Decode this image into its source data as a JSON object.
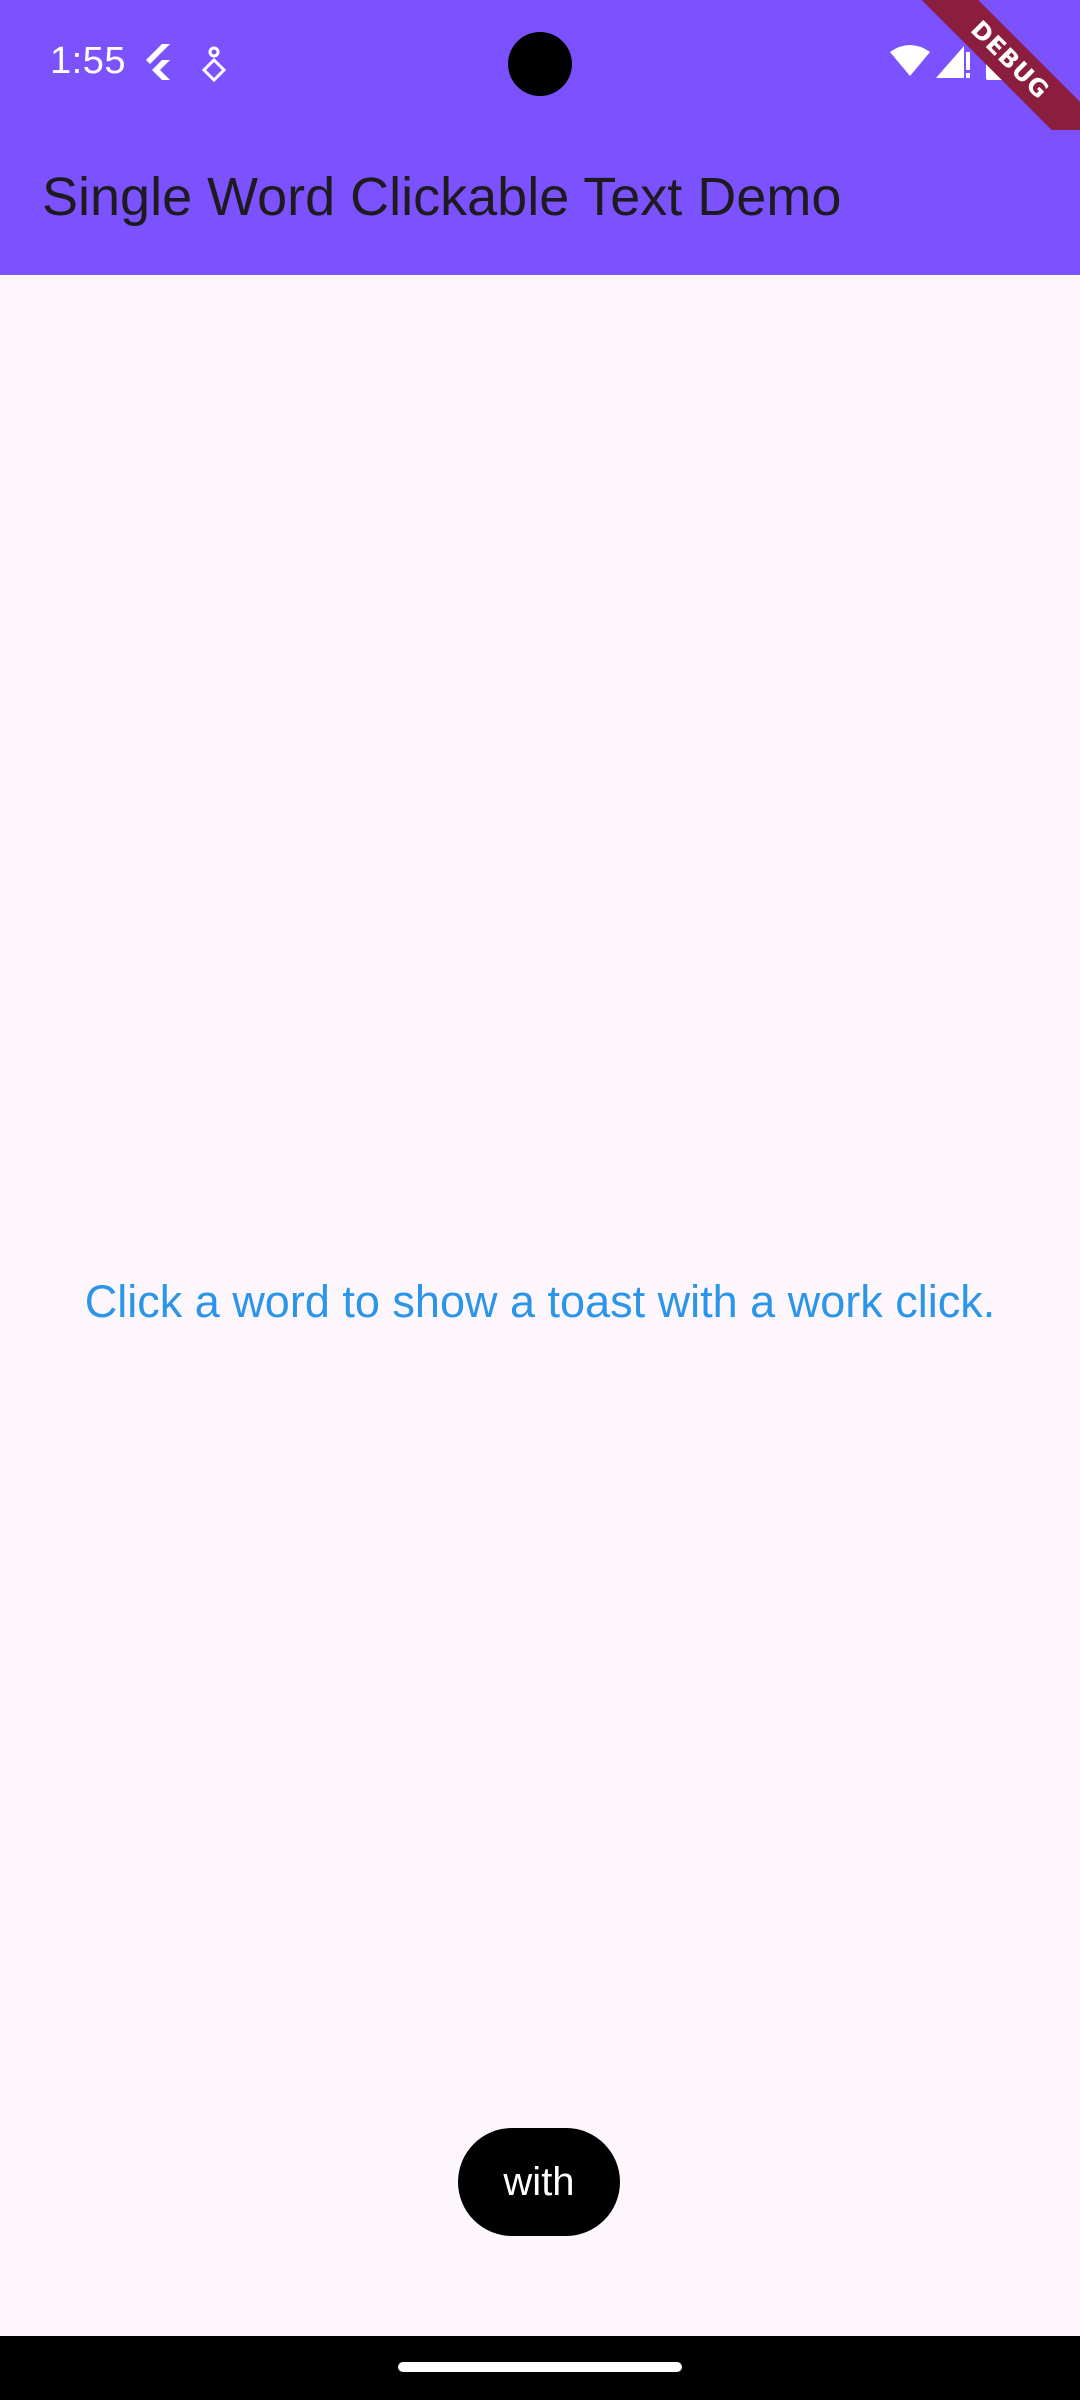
{
  "status_bar": {
    "time": "1:55",
    "left_icons": [
      "flutter-icon",
      "debug-bridge-icon"
    ],
    "right_icons": [
      "wifi-icon",
      "cell-signal-icon",
      "battery-icon"
    ]
  },
  "app_bar": {
    "title": "Single Word Clickable Text Demo",
    "banner": "DEBUG"
  },
  "body": {
    "words": [
      "Click",
      "a",
      "word",
      "to",
      "show",
      "a",
      "toast",
      "with",
      "a",
      "work",
      "click."
    ]
  },
  "toast": {
    "text": "with"
  },
  "colors": {
    "app_bar": "#7c52ff",
    "background": "#fdf7fd",
    "link_text": "#2b95e9",
    "debug_banner": "#8b1e3f",
    "toast_bg": "#000000"
  }
}
